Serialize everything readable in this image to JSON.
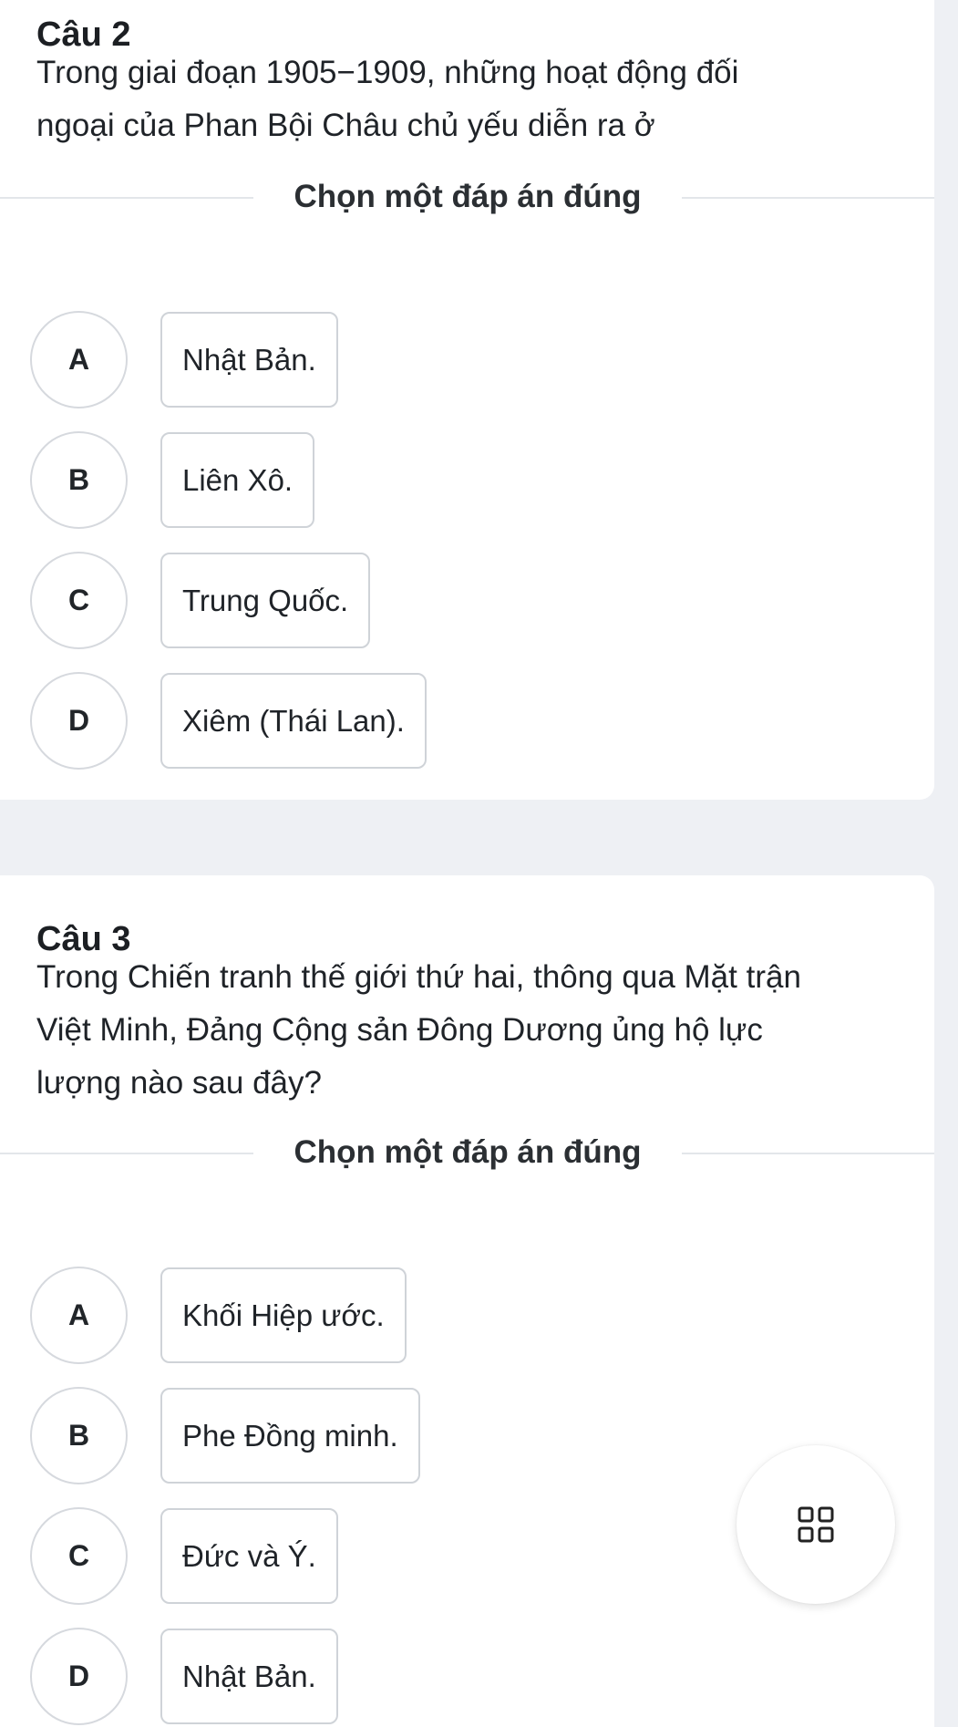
{
  "questions": [
    {
      "title": "Câu 2",
      "text_lines": [
        "Trong giai đoạn 1905−1909, những hoạt động đối",
        "ngoại của Phan Bội Châu chủ yếu diễn ra ở"
      ],
      "instruction": "Chọn một đáp án đúng",
      "options": [
        {
          "letter": "A",
          "text": "Nhật Bản."
        },
        {
          "letter": "B",
          "text": "Liên Xô."
        },
        {
          "letter": "C",
          "text": "Trung Quốc."
        },
        {
          "letter": "D",
          "text": "Xiêm (Thái Lan)."
        }
      ]
    },
    {
      "title": "Câu 3",
      "text_lines": [
        "Trong Chiến tranh thế giới thứ hai, thông qua Mặt trận",
        "Việt Minh, Đảng Cộng sản Đông Dương ủng hộ lực",
        "lượng nào sau đây?"
      ],
      "instruction": "Chọn một đáp án đúng",
      "options": [
        {
          "letter": "A",
          "text": "Khối Hiệp ước."
        },
        {
          "letter": "B",
          "text": "Phe Đồng minh."
        },
        {
          "letter": "C",
          "text": "Đức và Ý."
        },
        {
          "letter": "D",
          "text": "Nhật Bản."
        }
      ]
    }
  ],
  "fab": {
    "icon": "grid-icon"
  },
  "colors": {
    "background": "#eef0f4",
    "card": "#ffffff",
    "border": "#cfd3d8",
    "text": "#1f2328"
  }
}
